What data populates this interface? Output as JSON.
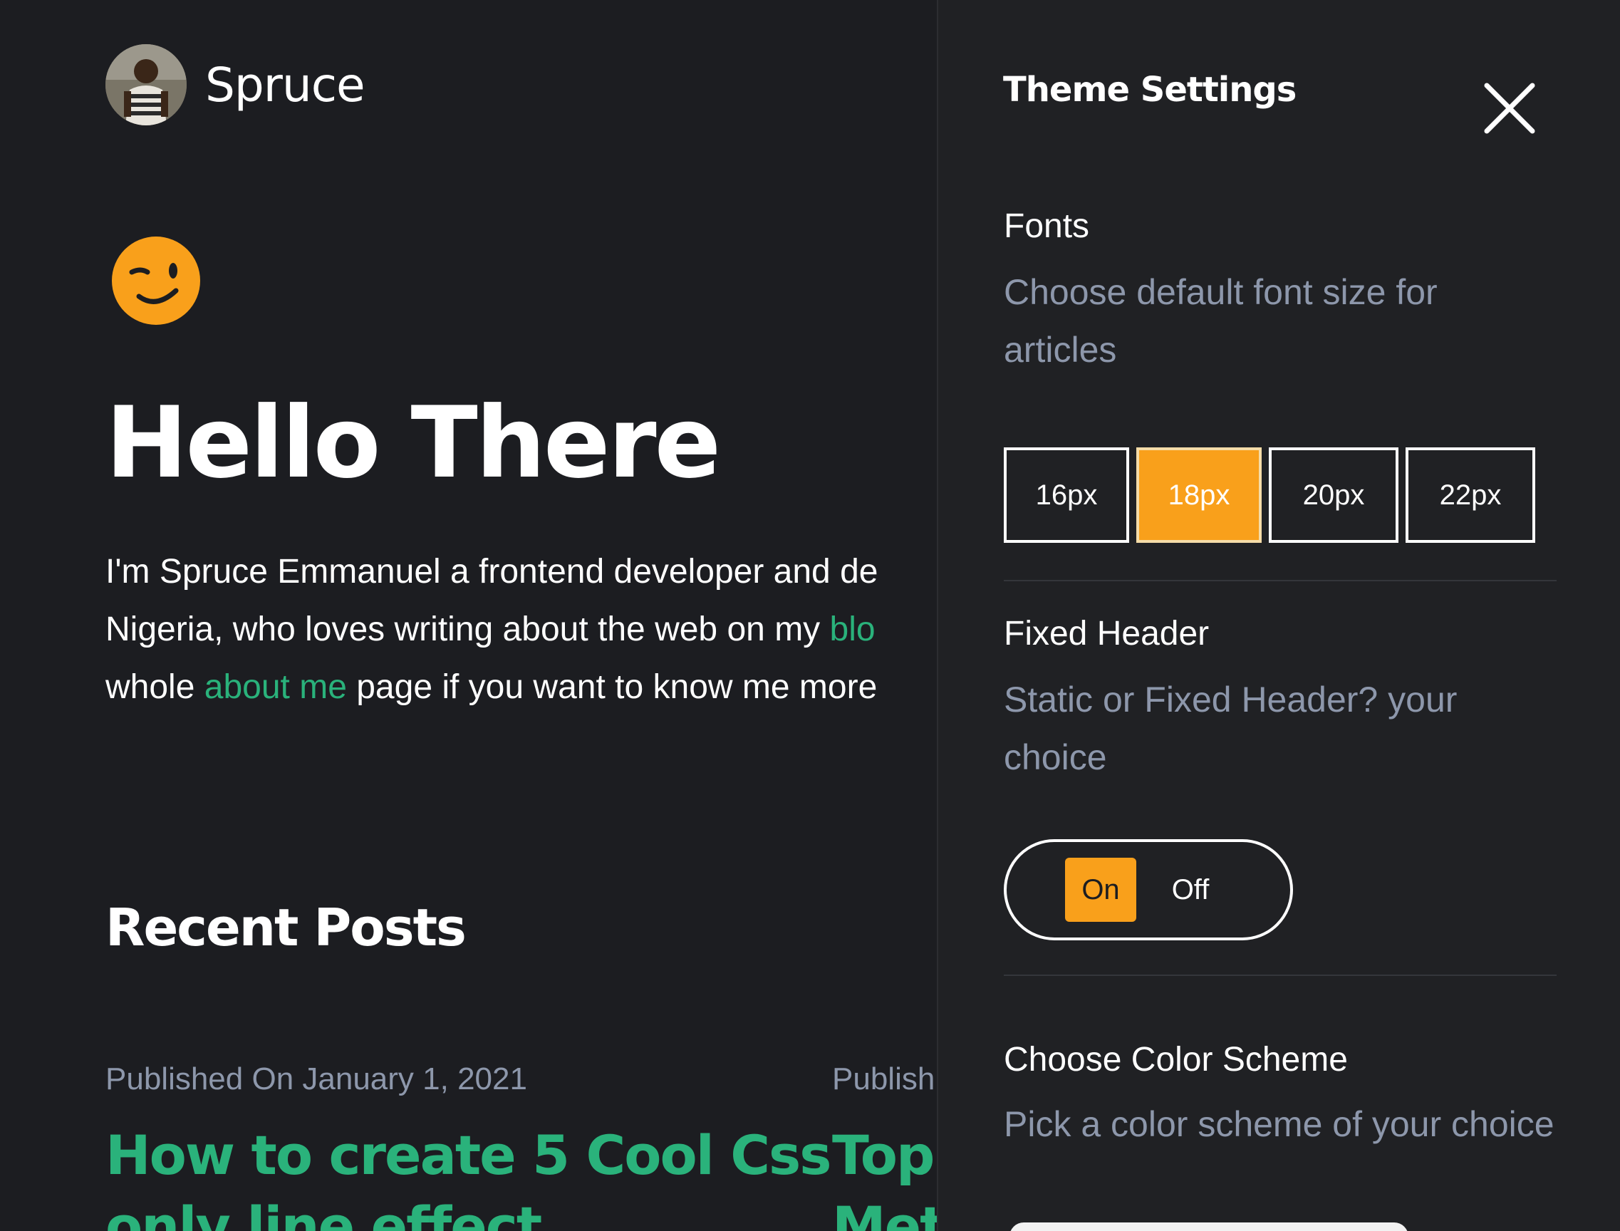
{
  "site": {
    "name": "Spruce"
  },
  "hero": {
    "title": "Hello There",
    "intro_line1": "I'm Spruce Emmanuel a frontend developer and de",
    "intro_line2_before": "Nigeria, who loves writing about the web on my ",
    "intro_line2_link": "blo",
    "intro_line3_before": "whole ",
    "intro_line3_link": "about me",
    "intro_line3_after": " page if you want to know me more"
  },
  "recent": {
    "title": "Recent Posts",
    "posts": [
      {
        "meta": "Published On January 1, 2021",
        "title_line1": "How to create 5 Cool Css",
        "title_line2": "only line effect"
      },
      {
        "meta": "Publish",
        "title_line1": "Top",
        "title_line2": "Met"
      }
    ]
  },
  "settings": {
    "title": "Theme Settings",
    "fonts": {
      "title": "Fonts",
      "description": "Choose default font size for articles",
      "sizes": [
        "16px",
        "18px",
        "20px",
        "22px"
      ],
      "selected": "18px"
    },
    "fixed_header": {
      "title": "Fixed Header",
      "description": "Static or Fixed Header? your choice",
      "on_label": "On",
      "off_label": "Off",
      "selected": "On"
    },
    "color_scheme": {
      "title": "Choose Color Scheme",
      "description": "Pick a color scheme of your choice"
    }
  },
  "colors": {
    "background": "#1c1d21",
    "drawer_background": "#202124",
    "accent_orange": "#f9a01b",
    "link_green": "#2ab27b",
    "muted_text": "#8d97ab"
  },
  "icons": {
    "avatar": "avatar-photo",
    "emoji": "winking-face-icon",
    "close": "close-icon"
  }
}
